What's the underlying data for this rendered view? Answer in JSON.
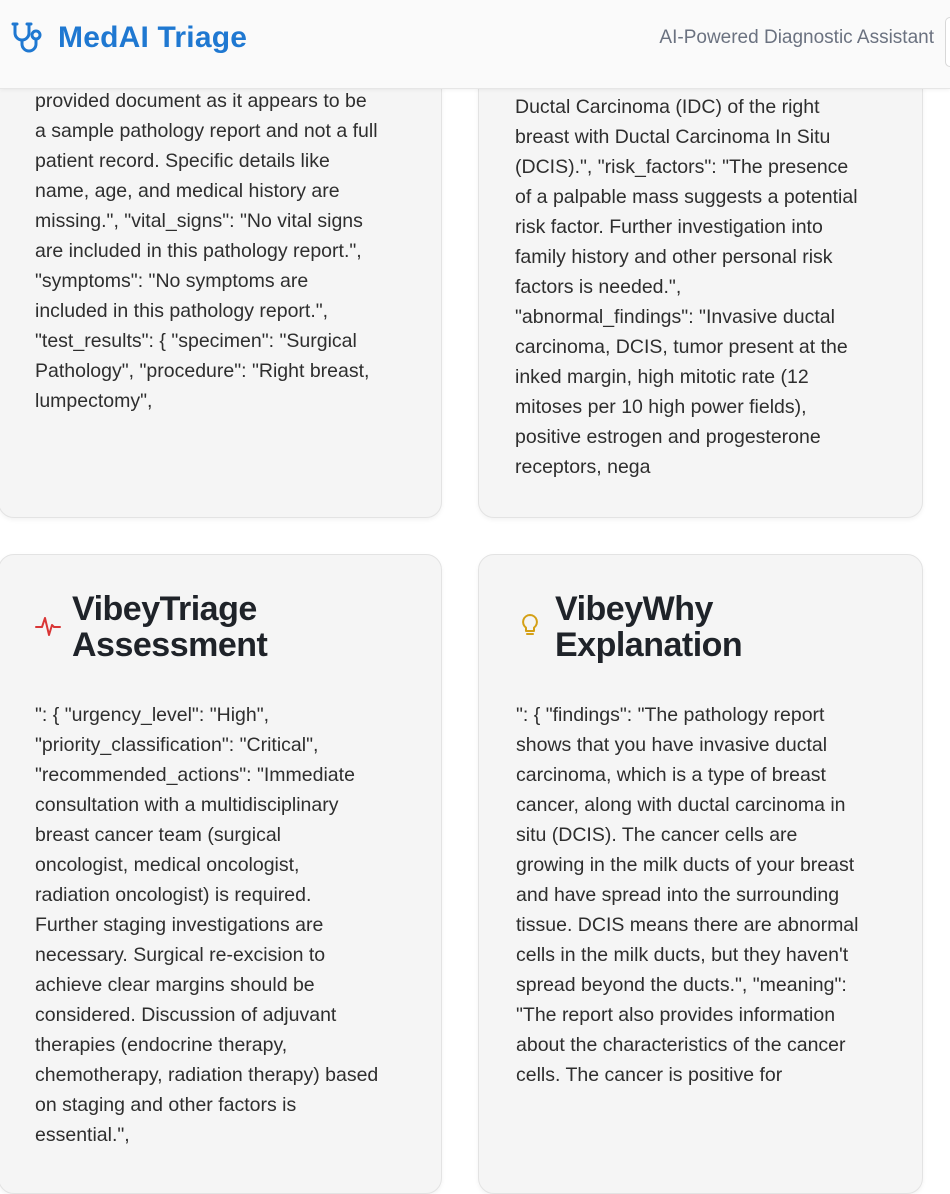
{
  "app": {
    "name": "MedAI Triage",
    "tagline": "AI-Powered Diagnostic Assistant",
    "brand_color": "#1f78d1",
    "logo_icon": "stethoscope-icon"
  },
  "cards": {
    "patient_summary": {
      "text": "provided document as it appears to be\na sample pathology report and not a full\npatient record. Specific details like\nname, age, and medical history are\nmissing.\", \"vital_signs\": \"No vital signs\nare included in this pathology report.\",\n\"symptoms\": \"No symptoms are\nincluded in this pathology report.\",\n\"test_results\": { \"specimen\": \"Surgical\nPathology\", \"procedure\": \"Right breast,\nlumpectomy\","
    },
    "clinical_analysis": {
      "text": "Ductal Carcinoma (IDC) of the right\nbreast with Ductal Carcinoma In Situ\n(DCIS).\", \"risk_factors\": \"The presence\nof a palpable mass suggests a potential\nrisk factor. Further investigation into\nfamily history and other personal risk\nfactors is needed.\",\n\"abnormal_findings\": \"Invasive ductal\ncarcinoma, DCIS, tumor present at the\ninked margin, high mitotic rate (12\nmitoses per 10 high power fields),\npositive estrogen and progesterone\nreceptors, nega"
    },
    "triage": {
      "title": "VibeyTriage\nAssessment",
      "icon": "heartbeat-icon",
      "icon_color": "#d93636",
      "text": "\": { \"urgency_level\": \"High\",\n\"priority_classification\": \"Critical\",\n\"recommended_actions\": \"Immediate\nconsultation with a multidisciplinary\nbreast cancer team (surgical\noncologist, medical oncologist,\nradiation oncologist) is required.\nFurther staging investigations are\nnecessary. Surgical re-excision to\nachieve clear margins should be\nconsidered. Discussion of adjuvant\ntherapies (endocrine therapy,\nchemotherapy, radiation therapy) based\non staging and other factors is\nessential.\","
    },
    "why": {
      "title": "VibeyWhy\nExplanation",
      "icon": "lightbulb-icon",
      "icon_color": "#d4a017",
      "text": "\": { \"findings\": \"The pathology report\nshows that you have invasive ductal\ncarcinoma, which is a type of breast\ncancer, along with ductal carcinoma in\nsitu (DCIS). The cancer cells are\ngrowing in the milk ducts of your breast\nand have spread into the surrounding\ntissue. DCIS means there are abnormal\ncells in the milk ducts, but they haven't\nspread beyond the ducts.\", \"meaning\":\n\"The report also provides information\nabout the characteristics of the cancer\ncells. The cancer is positive for"
    }
  }
}
